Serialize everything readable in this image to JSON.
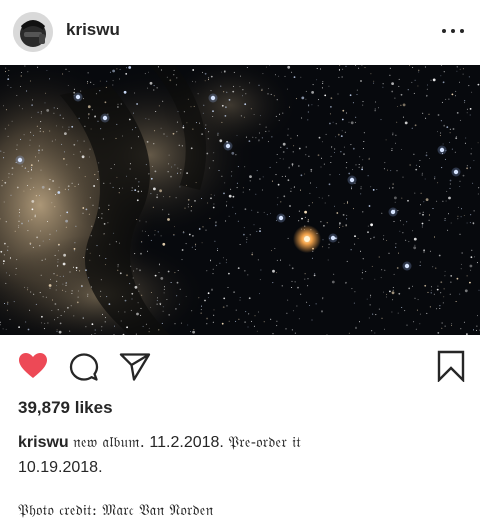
{
  "header": {
    "username": "kriswu",
    "more_icon": "more-horizontal-icon"
  },
  "post": {
    "image_description_icon": "galaxy-photo",
    "liked": true,
    "like_color": "#ed4956",
    "icons": {
      "like": "heart-icon",
      "comment": "comment-icon",
      "share": "paper-plane-icon",
      "save": "bookmark-icon"
    }
  },
  "likes_text": "39,879 likes",
  "caption": {
    "username": "kriswu",
    "part1": "𝔫𝔢𝔴 𝔞𝔩𝔟𝔲𝔪.",
    "part2": "11.2.2018.",
    "part3": "𝔓𝔯𝔢-𝔬𝔯𝔡𝔢𝔯 𝔦𝔱",
    "part4": "10.19.2018."
  },
  "credit": "𝔓𝔥𝔬𝔱𝔬 𝔠𝔯𝔢𝔡𝔦𝔱: 𝔐𝔞𝔯𝔠 𝔙𝔞𝔫 𝔑𝔬𝔯𝔡𝔢𝔫"
}
